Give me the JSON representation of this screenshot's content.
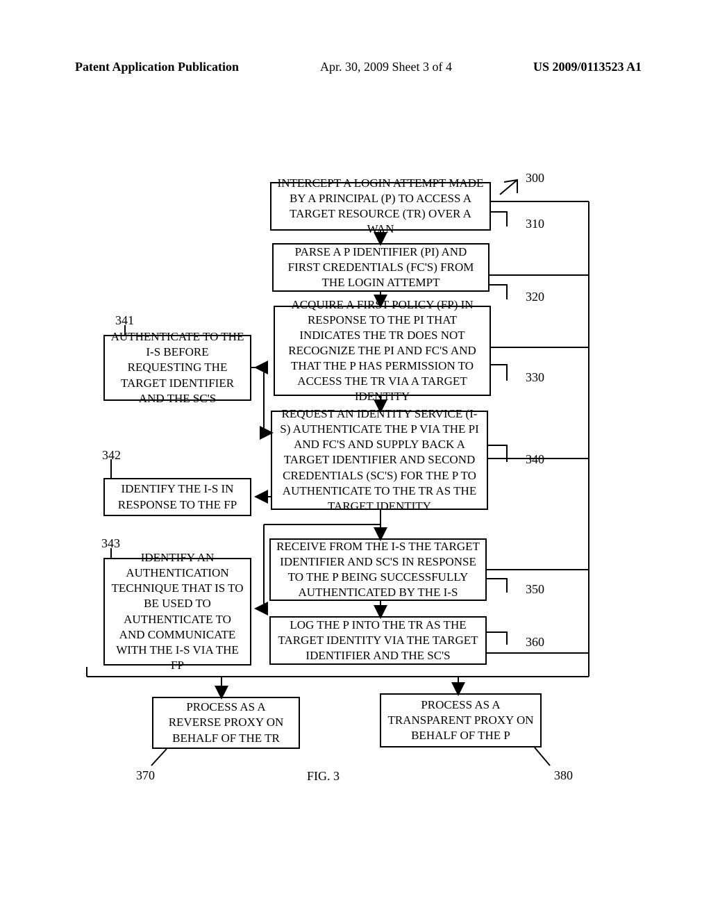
{
  "header": {
    "left": "Patent Application Publication",
    "mid": "Apr. 30, 2009  Sheet 3 of 4",
    "right": "US 2009/0113523 A1"
  },
  "labels": {
    "n300": "300",
    "n310": "310",
    "n320": "320",
    "n330": "330",
    "n340": "340",
    "n341": "341",
    "n342": "342",
    "n343": "343",
    "n350": "350",
    "n360": "360",
    "n370": "370",
    "n380": "380"
  },
  "boxes": {
    "b310": "INTERCEPT A LOGIN ATTEMPT MADE BY A PRINCIPAL (P) TO ACCESS A TARGET RESOURCE (TR) OVER A WAN",
    "b320": "PARSE A P IDENTIFIER (PI) AND FIRST CREDENTIALS (FC'S) FROM THE LOGIN ATTEMPT",
    "b330": "ACQUIRE A FIRST POLICY (FP) IN RESPONSE TO THE PI THAT INDICATES THE TR DOES NOT RECOGNIZE THE PI AND FC'S AND THAT THE P HAS PERMISSION TO ACCESS THE TR VIA A TARGET IDENTITY",
    "b340": "REQUEST AN IDENTITY SERVICE (I-S) AUTHENTICATE THE P VIA THE PI AND FC'S AND SUPPLY BACK A TARGET IDENTIFIER AND SECOND CREDENTIALS (SC'S) FOR THE P TO AUTHENTICATE TO THE TR AS THE TARGET IDENTITY",
    "b341": "AUTHENTICATE TO THE I-S BEFORE REQUESTING THE TARGET IDENTIFIER AND THE SC'S",
    "b342": "IDENTIFY THE I-S IN RESPONSE TO THE FP",
    "b343": "IDENTIFY AN AUTHENTICATION TECHNIQUE THAT IS TO BE USED TO AUTHENTICATE TO AND COMMUNICATE WITH THE I-S VIA THE FP",
    "b350": "RECEIVE FROM THE I-S THE TARGET IDENTIFIER AND SC'S IN RESPONSE TO THE P BEING SUCCESSFULLY AUTHENTICATED BY THE I-S",
    "b360": "LOG THE P INTO THE TR AS THE TARGET IDENTITY VIA THE TARGET IDENTIFIER AND THE SC'S",
    "b370": "PROCESS AS A REVERSE PROXY ON BEHALF OF THE TR",
    "b380": "PROCESS AS A TRANSPARENT PROXY ON BEHALF OF THE P"
  },
  "figure": "FIG. 3"
}
